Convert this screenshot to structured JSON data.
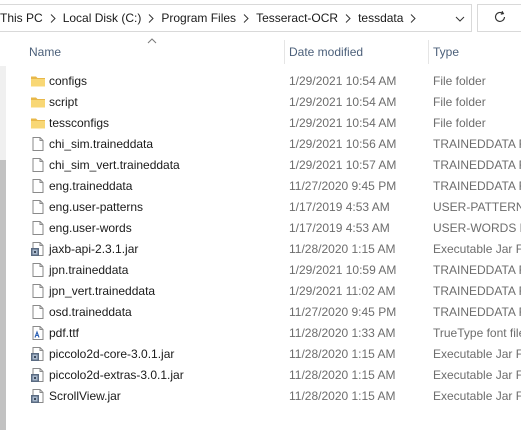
{
  "breadcrumb": [
    "This PC",
    "Local Disk (C:)",
    "Program Files",
    "Tesseract-OCR",
    "tessdata"
  ],
  "columns": {
    "name": "Name",
    "date": "Date modified",
    "type": "Type"
  },
  "files": [
    {
      "name": "configs",
      "date": "1/29/2021 10:54 AM",
      "type": "File folder",
      "icon": "folder"
    },
    {
      "name": "script",
      "date": "1/29/2021 10:54 AM",
      "type": "File folder",
      "icon": "folder"
    },
    {
      "name": "tessconfigs",
      "date": "1/29/2021 10:54 AM",
      "type": "File folder",
      "icon": "folder"
    },
    {
      "name": "chi_sim.traineddata",
      "date": "1/29/2021 10:56 AM",
      "type": "TRAINEDDATA File",
      "icon": "file"
    },
    {
      "name": "chi_sim_vert.traineddata",
      "date": "1/29/2021 10:57 AM",
      "type": "TRAINEDDATA File",
      "icon": "file"
    },
    {
      "name": "eng.traineddata",
      "date": "11/27/2020 9:45 PM",
      "type": "TRAINEDDATA File",
      "icon": "file"
    },
    {
      "name": "eng.user-patterns",
      "date": "1/17/2019 4:53 AM",
      "type": "USER-PATTERNS File",
      "icon": "file"
    },
    {
      "name": "eng.user-words",
      "date": "1/17/2019 4:53 AM",
      "type": "USER-WORDS File",
      "icon": "file"
    },
    {
      "name": "jaxb-api-2.3.1.jar",
      "date": "11/28/2020 1:15 AM",
      "type": "Executable Jar File",
      "icon": "jar"
    },
    {
      "name": "jpn.traineddata",
      "date": "1/29/2021 10:59 AM",
      "type": "TRAINEDDATA File",
      "icon": "file"
    },
    {
      "name": "jpn_vert.traineddata",
      "date": "1/29/2021 11:02 AM",
      "type": "TRAINEDDATA File",
      "icon": "file"
    },
    {
      "name": "osd.traineddata",
      "date": "11/27/2020 9:45 PM",
      "type": "TRAINEDDATA File",
      "icon": "file"
    },
    {
      "name": "pdf.ttf",
      "date": "11/28/2020 1:33 AM",
      "type": "TrueType font file",
      "icon": "font"
    },
    {
      "name": "piccolo2d-core-3.0.1.jar",
      "date": "11/28/2020 1:15 AM",
      "type": "Executable Jar File",
      "icon": "jar"
    },
    {
      "name": "piccolo2d-extras-3.0.1.jar",
      "date": "11/28/2020 1:15 AM",
      "type": "Executable Jar File",
      "icon": "jar"
    },
    {
      "name": "ScrollView.jar",
      "date": "11/28/2020 1:15 AM",
      "type": "Executable Jar File",
      "icon": "jar"
    }
  ],
  "colors": {
    "folder": "#f8d775",
    "folder_dark": "#e8b84a",
    "header_text": "#4c607a",
    "secondary_text": "#6d6d6d"
  }
}
